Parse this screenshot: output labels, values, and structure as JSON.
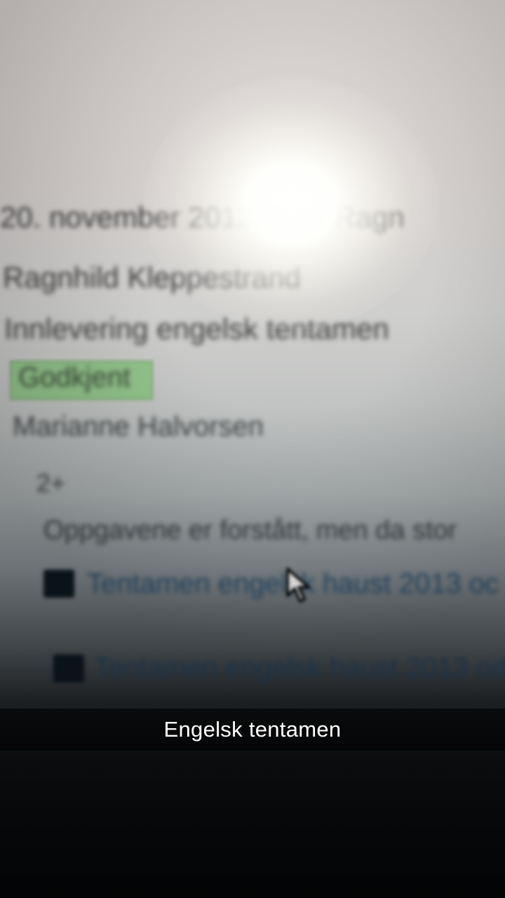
{
  "photo": {
    "date_line": "20. november 2013, 2 av Ragn",
    "author_line": "Ragnhild Kleppestrand",
    "title_line": "Innlevering engelsk tentamen",
    "status_badge": "Godkjent",
    "teacher_line": "Marianne Halvorsen",
    "grade_line": "2+",
    "comment_line": "Oppgavene er forstått, men da stor",
    "attachments": [
      {
        "icon": "file-icon",
        "label": "Tentamen engelsk haust 2013 oc"
      },
      {
        "icon": "file-icon",
        "label": "Tentamen engelsk haust 2013 od"
      }
    ],
    "cursor": {
      "icon": "mouse-cursor-icon"
    },
    "badge_color": "#93c48c",
    "link_color": "#24496a"
  },
  "caption": {
    "text": "Engelsk tentamen"
  }
}
